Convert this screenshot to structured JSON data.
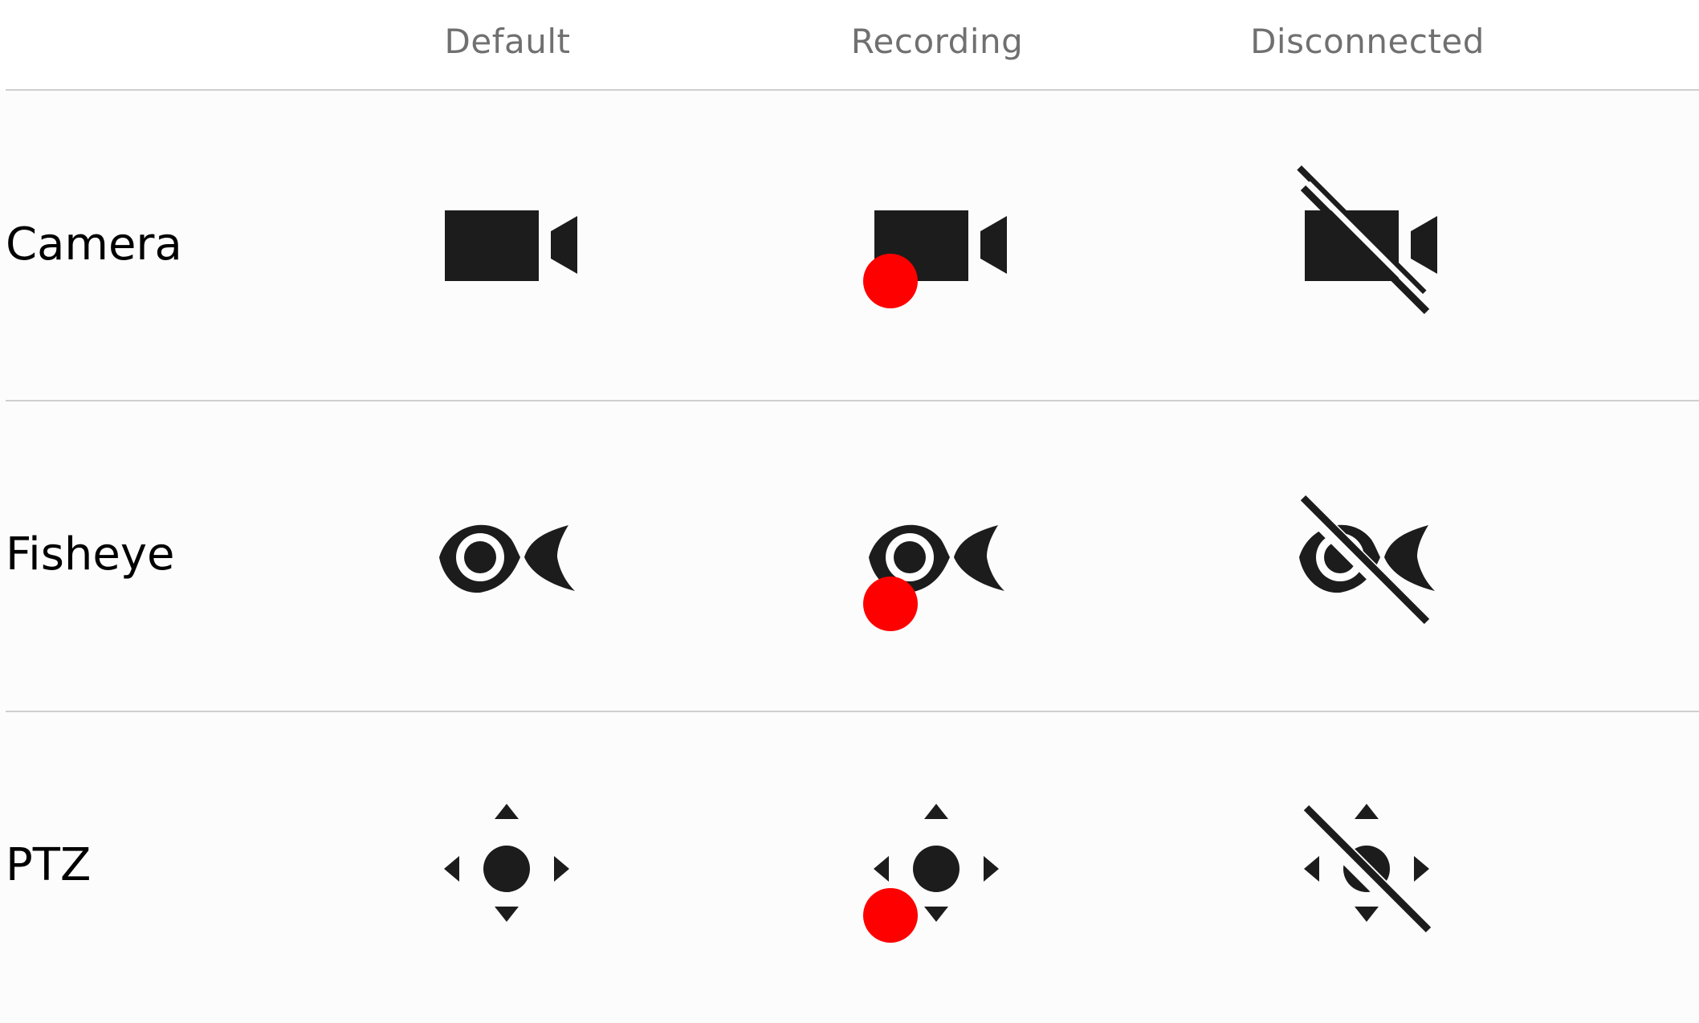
{
  "columns": [
    "Default",
    "Recording",
    "Disconnected"
  ],
  "rows": [
    {
      "label": "Camera",
      "icon": "video-camera-icon"
    },
    {
      "label": "Fisheye",
      "icon": "fisheye-icon"
    },
    {
      "label": "PTZ",
      "icon": "ptz-icon"
    }
  ],
  "colors": {
    "icon": "#1c1c1c",
    "recording_dot": "#ff0000",
    "header_text": "#707070",
    "divider": "#cfcfcf",
    "background": "#fcfcfc"
  }
}
